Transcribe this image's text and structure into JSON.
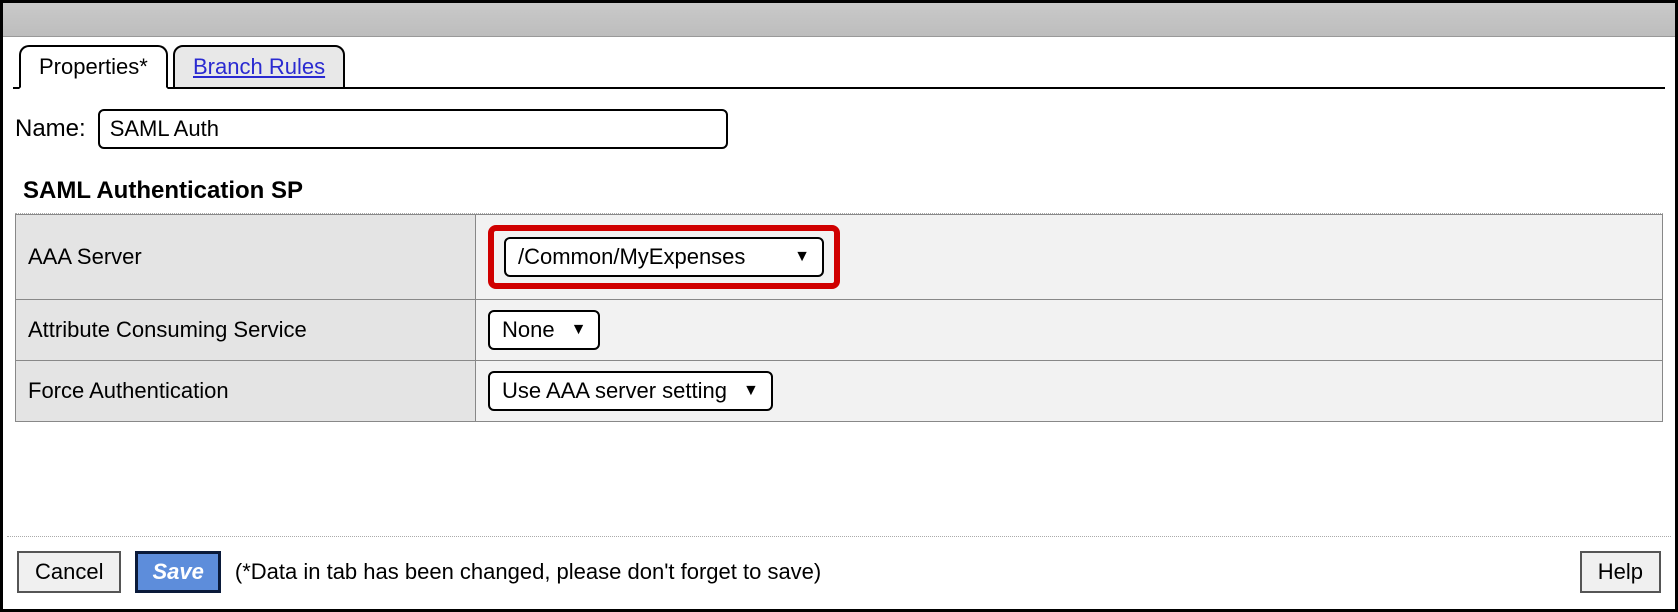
{
  "tabs": {
    "properties": "Properties*",
    "branch_rules": "Branch Rules"
  },
  "name_section": {
    "label": "Name:",
    "value": "SAML Auth"
  },
  "section_title": "SAML Authentication SP",
  "rows": {
    "aaa_server": {
      "label": "AAA Server",
      "value": "/Common/MyExpenses"
    },
    "attr_consuming": {
      "label": "Attribute Consuming Service",
      "value": "None"
    },
    "force_auth": {
      "label": "Force Authentication",
      "value": "Use AAA server setting"
    }
  },
  "footer": {
    "cancel": "Cancel",
    "save": "Save",
    "note": "(*Data in tab has been changed, please don't forget to save)",
    "help": "Help"
  }
}
